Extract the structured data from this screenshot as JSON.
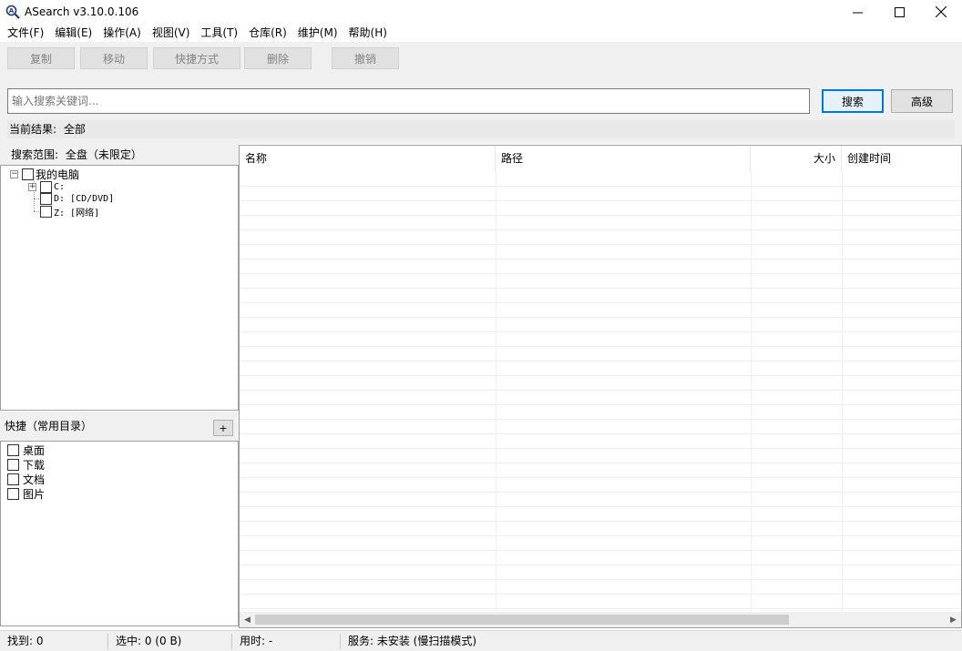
{
  "window": {
    "title": "ASearch v3.10.0.106",
    "controls": {
      "minimize": "—",
      "maximize": "☐",
      "close": "✕"
    }
  },
  "menu": [
    "文件(F)",
    "编辑(E)",
    "操作(A)",
    "视图(V)",
    "工具(T)",
    "仓库(R)",
    "维护(M)",
    "帮助(H)"
  ],
  "toolbar": {
    "copy": "复制",
    "move": "移动",
    "shortcut": "快捷方式",
    "delete": "删除",
    "undo": "撤销"
  },
  "search": {
    "placeholder": "输入搜索关键词...",
    "value": "",
    "search_button": "搜索",
    "advanced_button": "高级"
  },
  "result": {
    "label": "当前结果:",
    "value": "全部"
  },
  "scope": {
    "label": "搜索范围:",
    "value": "全盘（未限定）",
    "tree": {
      "root": "我的电脑",
      "drives": [
        "C:",
        "D: [CD/DVD]",
        "Z: [网络]"
      ]
    }
  },
  "shortcuts": {
    "title": "快捷（常用目录）",
    "add": "+",
    "items": [
      "桌面",
      "下载",
      "文档",
      "图片"
    ]
  },
  "table": {
    "columns": [
      "名称",
      "路径",
      "大小",
      "创建时间"
    ]
  },
  "status": {
    "found": "找到: 0",
    "selected": "选中: 0 (0 B)",
    "elapsed": "用时: -",
    "service": "服务: 未安装 (慢扫描模式)"
  }
}
